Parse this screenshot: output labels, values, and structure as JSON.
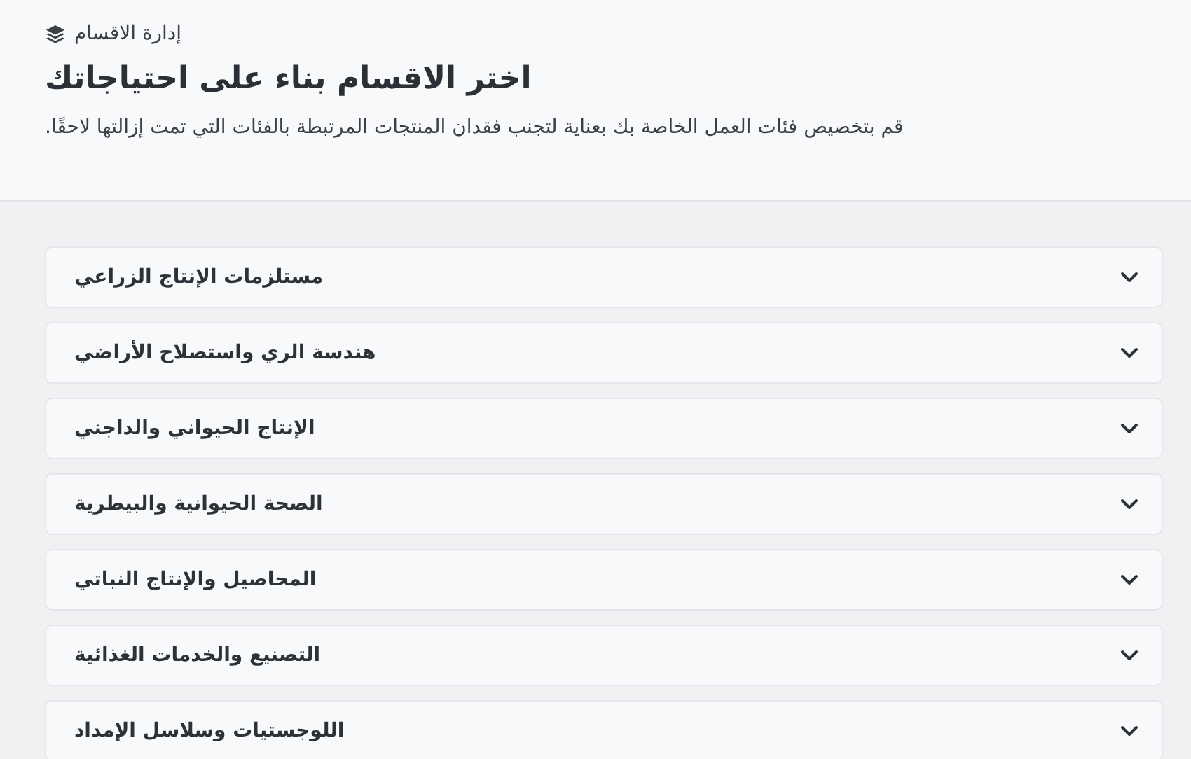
{
  "header": {
    "breadcrumb": "إدارة الاقسام",
    "title": "اختر الاقسام بناء على احتياجاتك",
    "description": "قم بتخصيص فئات العمل الخاصة بك بعناية لتجنب فقدان المنتجات المرتبطة بالفئات التي تمت إزالتها لاحقًا."
  },
  "sections": [
    {
      "label": "مستلزمات الإنتاج الزراعي",
      "expanded": false
    },
    {
      "label": "هندسة الري واستصلاح الأراضي",
      "expanded": false
    },
    {
      "label": "الإنتاج الحيواني والداجني",
      "expanded": false
    },
    {
      "label": "الصحة الحيوانية والبيطرية",
      "expanded": false
    },
    {
      "label": "المحاصيل والإنتاج النباتي",
      "expanded": false
    },
    {
      "label": "التصنيع والخدمات الغذائية",
      "expanded": false
    },
    {
      "label": "اللوجستيات وسلاسل الإمداد",
      "expanded": false
    }
  ]
}
